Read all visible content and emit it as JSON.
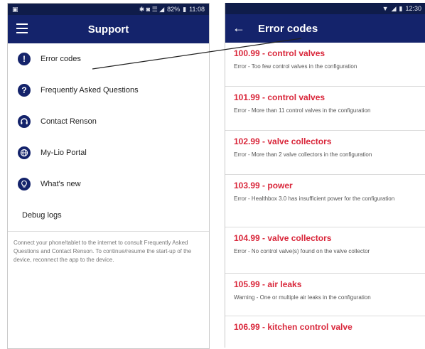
{
  "left_screen": {
    "status": {
      "time": "11:08",
      "battery": "82%",
      "icons": "✱ ◙ ☰ ◢"
    },
    "title": "Support",
    "menu": [
      {
        "label": "Error codes",
        "icon": "exclamation-icon"
      },
      {
        "label": "Frequently Asked Questions",
        "icon": "question-icon"
      },
      {
        "label": "Contact Renson",
        "icon": "headset-icon"
      },
      {
        "label": "My-Lio Portal",
        "icon": "globe-icon"
      },
      {
        "label": "What's new",
        "icon": "lightbulb-icon"
      }
    ],
    "debug_label": "Debug logs",
    "hint": "Connect your phone/tablet to the internet to consult Frequently Asked Questions and Contact Renson. To continue/resume the start-up of the device, reconnect the app to the device."
  },
  "right_screen": {
    "status": {
      "time": "12:30"
    },
    "title": "Error codes",
    "errors": [
      {
        "title": "100.99 - control valves",
        "desc": "Error - Too few control valves in the configuration"
      },
      {
        "title": "101.99 - control valves",
        "desc": "Error - More than 11 control valves in the configuration"
      },
      {
        "title": "102.99 - valve collectors",
        "desc": "Error - More than 2 valve collectors in the configuration"
      },
      {
        "title": "103.99 - power",
        "desc": "Error - Healthbox 3.0 has insufficient power for the configuration"
      },
      {
        "title": "104.99 - valve collectors",
        "desc": "Error - No control valve(s) found on the valve collector"
      },
      {
        "title": "105.99 - air leaks",
        "desc": "Warning - One or multiple air leaks in the configuration"
      },
      {
        "title": "106.99 - kitchen control valve",
        "desc": ""
      }
    ]
  },
  "colors": {
    "appbar": "#14236b",
    "statusbar": "#0f1c4a",
    "error_title": "#d9263a",
    "icon_bg": "#14236b"
  }
}
